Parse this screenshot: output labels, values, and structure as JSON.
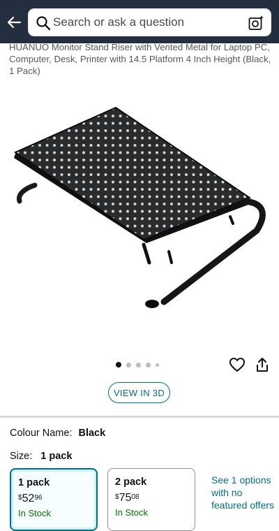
{
  "header": {
    "search_placeholder": "Search or ask a question",
    "bg_color": "#232f3e"
  },
  "product": {
    "title": "HUANUO Monitor Stand Riser with Vented Metal for Laptop PC, Computer, Desk, Printer with 14.5 Platform 4 Inch Height (Black, 1 Pack)",
    "image_alt": "HUANUO Monitor Stand Riser"
  },
  "gallery": {
    "dot_count": 5,
    "active_index": 0
  },
  "view3d_label": "VIEW IN 3D",
  "colour": {
    "label": "Colour Name:",
    "value": "Black"
  },
  "size": {
    "label": "Size:",
    "value": "1 pack",
    "options": [
      {
        "name": "1 pack",
        "currency": "$",
        "whole": "52",
        "fraction": "96",
        "stock": "In Stock",
        "selected": true
      },
      {
        "name": "2 pack",
        "currency": "$",
        "whole": "75",
        "fraction": "08",
        "stock": "In Stock",
        "selected": false
      }
    ],
    "more_options": "See 1 options with no featured offers"
  },
  "colors": {
    "accent": "#007185",
    "in_stock": "#007600"
  }
}
